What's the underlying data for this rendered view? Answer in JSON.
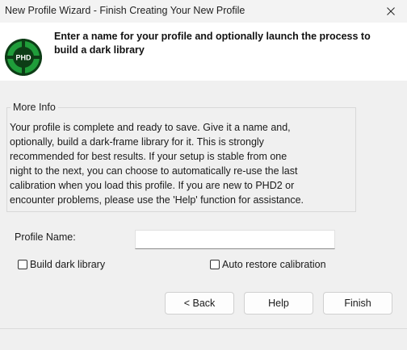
{
  "window": {
    "title": "New Profile Wizard - Finish Creating Your New Profile"
  },
  "header": {
    "logo_text": "PHD",
    "heading": "Enter a name for your profile and optionally launch the process to build a dark library"
  },
  "more_info": {
    "group_label": "More Info",
    "lines": [
      "Your profile is complete and ready to save.  Give it a name and,",
      "optionally, build a dark-frame library for it. This is strongly",
      "recommended for best results. If your setup is stable from one",
      "night to the next, you can choose to automatically re-use the last",
      "calibration when you load this profile. If you are new to PHD2 or",
      "encounter problems, please use the 'Help' function for assistance."
    ]
  },
  "form": {
    "profile_name_label": "Profile Name:",
    "profile_name_value": "",
    "build_dark_library_label": "Build dark library",
    "build_dark_library_checked": false,
    "auto_restore_label": "Auto restore calibration",
    "auto_restore_checked": false
  },
  "buttons": {
    "back": "< Back",
    "help": "Help",
    "finish": "Finish"
  },
  "colors": {
    "logo_green": "#1f9d3a",
    "logo_dark": "#0d3d16"
  }
}
